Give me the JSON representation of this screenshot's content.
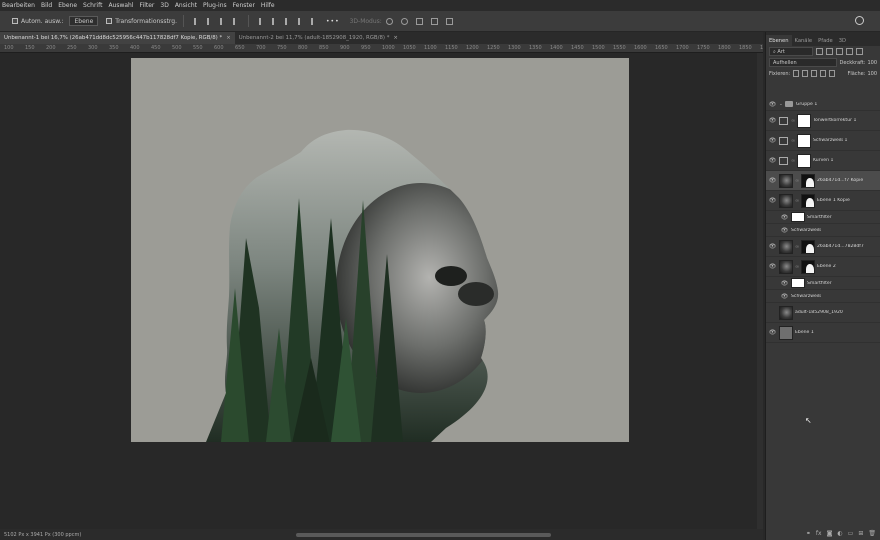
{
  "menu": [
    "Bearbeiten",
    "Bild",
    "Ebene",
    "Schrift",
    "Auswahl",
    "Filter",
    "3D",
    "Ansicht",
    "Plug-ins",
    "Fenster",
    "Hilfe"
  ],
  "options": {
    "auto_select_label": "Autom. ausw.:",
    "auto_select_value": "Ebene",
    "transform_label": "Transformationsstrg.",
    "mode_label": "3D-Modus:"
  },
  "tabs": [
    {
      "label": "Unbenannt-1 bei 16,7% (26ab471dd8dc525956c447b117828df7 Kopie, RGB/8) *",
      "active": true
    },
    {
      "label": "Unbenannt-2 bei 11,7% (adult-1852908_1920, RGB/8) *",
      "active": false
    }
  ],
  "ruler_ticks": [
    "100",
    "150",
    "200",
    "250",
    "300",
    "350",
    "400",
    "450",
    "500",
    "550",
    "600",
    "650",
    "700",
    "750",
    "800",
    "850",
    "900",
    "950",
    "1000",
    "1050",
    "1100",
    "1150",
    "1200",
    "1250",
    "1300",
    "1350",
    "1400",
    "1450",
    "1500",
    "1550",
    "1600",
    "1650",
    "1700",
    "1750",
    "1800",
    "1850",
    "1900"
  ],
  "status": "5102 Px x 3941 Px (300 ppcm)",
  "panel": {
    "tabs": [
      "Ebenen",
      "Kanäle",
      "Pfade",
      "3D"
    ],
    "filter_label": "Art",
    "blend_mode": "Aufhellen",
    "opacity_label": "Deckkraft:",
    "opacity_value": "100",
    "lock_label": "Fixieren:",
    "fill_label": "Fläche:",
    "fill_value": "100"
  },
  "layers": [
    {
      "name": "Gruppe 1",
      "kind": "group",
      "visible": true
    },
    {
      "name": "Tonwertkorrektur 1",
      "kind": "adjustment",
      "visible": true
    },
    {
      "name": "Schwarzweiß 1",
      "kind": "adjustment",
      "visible": true
    },
    {
      "name": "Kurven 1",
      "kind": "adjustment",
      "visible": true
    },
    {
      "name": "26ab471d...f7 Kopie",
      "kind": "image-mask",
      "visible": true,
      "selected": true
    },
    {
      "name": "Ebene 1 Kopie",
      "kind": "image-mask",
      "visible": true
    },
    {
      "name": "Smartfilter",
      "kind": "smartfilter",
      "visible": true
    },
    {
      "name": "Schwarzweiß",
      "kind": "filter",
      "visible": true
    },
    {
      "name": "26ab471d...7828df7",
      "kind": "image-mask",
      "visible": true
    },
    {
      "name": "Ebene 2",
      "kind": "image-mask",
      "visible": true
    },
    {
      "name": "Smartfilter",
      "kind": "smartfilter",
      "visible": true
    },
    {
      "name": "Schwarzweiß",
      "kind": "filter",
      "visible": true
    },
    {
      "name": "adult-1852908_1920",
      "kind": "image",
      "visible": false
    },
    {
      "name": "Ebene 1",
      "kind": "solid",
      "visible": true
    }
  ]
}
